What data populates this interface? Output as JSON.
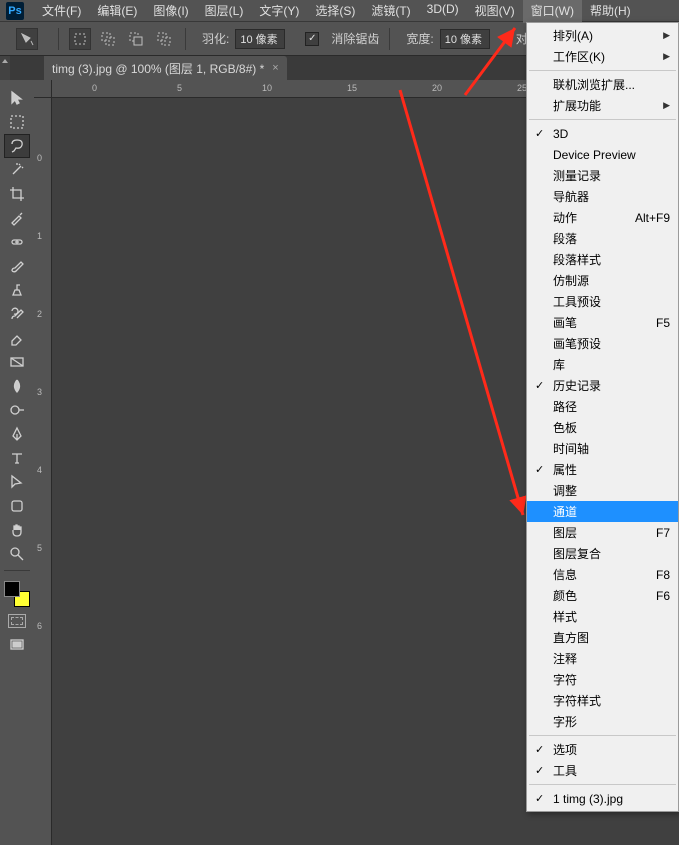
{
  "menu": {
    "items": [
      "文件(F)",
      "编辑(E)",
      "图像(I)",
      "图层(L)",
      "文字(Y)",
      "选择(S)",
      "滤镜(T)",
      "3D(D)",
      "视图(V)",
      "窗口(W)",
      "帮助(H)"
    ],
    "active_index": 9
  },
  "options": {
    "feather_label": "羽化:",
    "feather_value": "10 像素",
    "antialias_label": "消除锯齿",
    "width_label": "宽度:",
    "width_value": "10 像素",
    "contrast_label": "对比"
  },
  "document": {
    "tab_title": "timg (3).jpg @ 100% (图层 1, RGB/8#) *"
  },
  "ruler": {
    "h_ticks": [
      "0",
      "5",
      "10",
      "15",
      "20",
      "25"
    ],
    "v_ticks": [
      "0",
      "1",
      "2",
      "3",
      "4",
      "5",
      "6"
    ]
  },
  "dropdown": {
    "groups": [
      [
        {
          "label": "排列(A)",
          "submenu": true
        },
        {
          "label": "工作区(K)",
          "submenu": true
        }
      ],
      [
        {
          "label": "联机浏览扩展..."
        },
        {
          "label": "扩展功能",
          "submenu": true
        }
      ],
      [
        {
          "label": "3D",
          "checked": true
        },
        {
          "label": "Device Preview"
        },
        {
          "label": "测量记录"
        },
        {
          "label": "导航器"
        },
        {
          "label": "动作",
          "shortcut": "Alt+F9"
        },
        {
          "label": "段落"
        },
        {
          "label": "段落样式"
        },
        {
          "label": "仿制源"
        },
        {
          "label": "工具预设"
        },
        {
          "label": "画笔",
          "shortcut": "F5"
        },
        {
          "label": "画笔预设"
        },
        {
          "label": "库"
        },
        {
          "label": "历史记录",
          "checked": true
        },
        {
          "label": "路径"
        },
        {
          "label": "色板"
        },
        {
          "label": "时间轴"
        },
        {
          "label": "属性",
          "checked": true
        },
        {
          "label": "调整"
        },
        {
          "label": "通道",
          "highlight": true
        },
        {
          "label": "图层",
          "shortcut": "F7"
        },
        {
          "label": "图层复合"
        },
        {
          "label": "信息",
          "shortcut": "F8"
        },
        {
          "label": "颜色",
          "shortcut": "F6"
        },
        {
          "label": "样式"
        },
        {
          "label": "直方图"
        },
        {
          "label": "注释"
        },
        {
          "label": "字符"
        },
        {
          "label": "字符样式"
        },
        {
          "label": "字形"
        }
      ],
      [
        {
          "label": "选项",
          "checked": true
        },
        {
          "label": "工具",
          "checked": true
        }
      ],
      [
        {
          "label": "1 timg (3).jpg",
          "checked": true
        }
      ]
    ]
  }
}
